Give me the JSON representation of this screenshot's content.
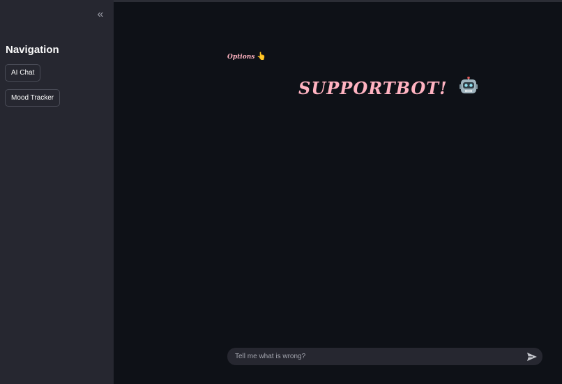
{
  "sidebar": {
    "collapse_icon": "double-chevron-left-icon",
    "collapse_glyph": "«",
    "title": "Navigation",
    "buttons": [
      {
        "label": "AI Chat"
      },
      {
        "label": "Mood Tracker"
      }
    ]
  },
  "main": {
    "options_label": "Options",
    "options_icon": "pointing-hand-icon",
    "options_glyph": "👆",
    "title": "SUPPORTBOT!",
    "title_icon": "robot-icon",
    "title_color": "#ffb3c1"
  },
  "chat": {
    "placeholder": "Tell me what is wrong?",
    "send_icon": "send-icon"
  },
  "colors": {
    "background": "#0e1117",
    "sidebar": "#262730",
    "accent_pink": "#ffb3c1"
  }
}
